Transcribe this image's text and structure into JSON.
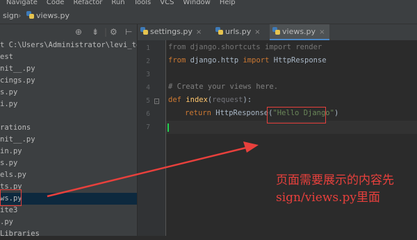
{
  "menu": [
    "Navigate",
    "Code",
    "Refactor",
    "Run",
    "Tools",
    "VCS",
    "Window",
    "Help"
  ],
  "breadcrumb": {
    "folder": "sign",
    "file": "views.py"
  },
  "tree": [
    {
      "text": "t  C:\\Users\\Administrator\\levi_tes"
    },
    {
      "text": "est"
    },
    {
      "text": "nit__.py"
    },
    {
      "text": "cings.py"
    },
    {
      "text": "s.py"
    },
    {
      "text": "i.py"
    },
    {
      "text": ""
    },
    {
      "text": "rations"
    },
    {
      "text": "nit__.py"
    },
    {
      "text": "in.py"
    },
    {
      "text": "s.py"
    },
    {
      "text": "els.py"
    },
    {
      "text": "ts.py"
    },
    {
      "text": "ws.py",
      "selected": true
    },
    {
      "text": "ite3"
    },
    {
      "text": ".py"
    },
    {
      "text": " Libraries"
    }
  ],
  "tabs": [
    {
      "label": "settings.py",
      "active": false
    },
    {
      "label": "urls.py",
      "active": false
    },
    {
      "label": "views.py",
      "active": true
    }
  ],
  "code": {
    "line_numbers": [
      "1",
      "2",
      "3",
      "4",
      "5",
      "6",
      "7"
    ],
    "l1": "from django.shortcuts import render",
    "l2_kw1": "from",
    "l2_mod": " django.http ",
    "l2_kw2": "import",
    "l2_name": " HttpResponse",
    "l4": "# Create your views here.",
    "l5_kw": "def",
    "l5_fn": "index",
    "l5_open": "(",
    "l5_param": "request",
    "l5_close": "):",
    "l6_kw": "return",
    "l6_call": " HttpResponse(",
    "l6_str": "\"Hello Django\"",
    "l6_close": ")"
  },
  "caption": {
    "line1": "页面需要展示的内容先",
    "line2": "sign/views.py里面"
  },
  "colors": {
    "annotation": "#e8403c",
    "caret": "#21d150"
  }
}
